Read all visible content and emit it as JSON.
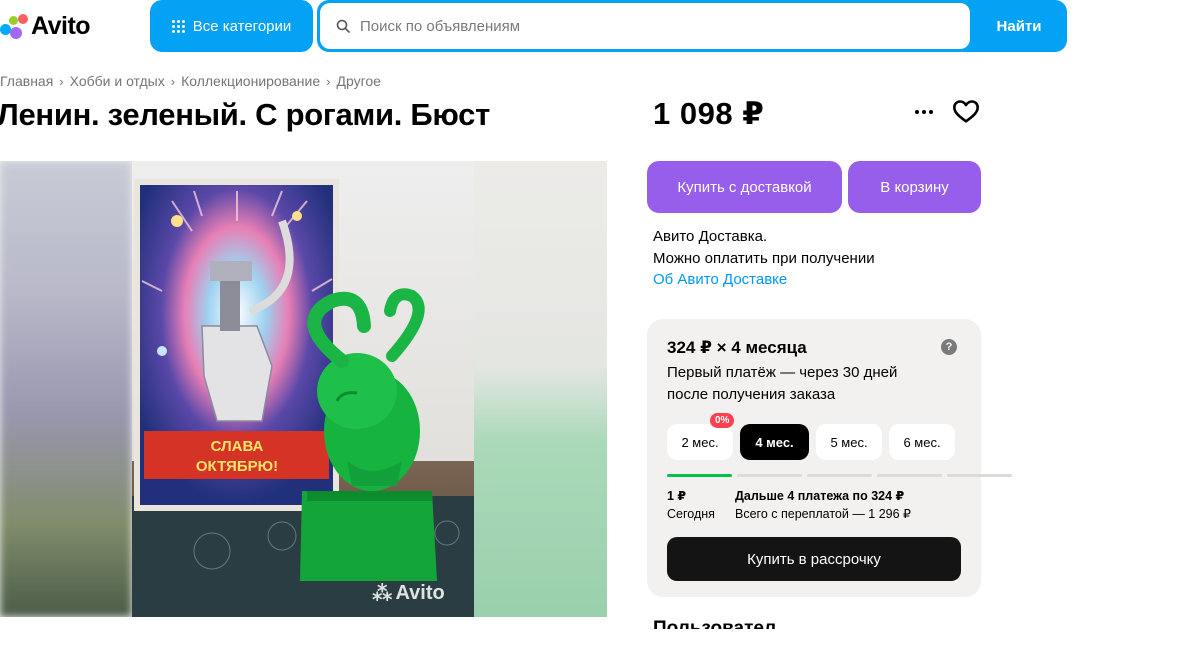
{
  "header": {
    "logo_text": "Avito",
    "logo_colors": [
      "#00aaff",
      "#97cf26",
      "#a169f7",
      "#ff6163"
    ],
    "categories_label": "Все категории",
    "search_placeholder": "Поиск по объявлениям",
    "find_label": "Найти",
    "accent_color": "#04a2f5"
  },
  "breadcrumb": [
    "Главная",
    "Хобби и отдых",
    "Коллекционирование",
    "Другое"
  ],
  "listing": {
    "title": "Ленин. зеленый. С рогами. Бюст",
    "price": "1 098 ₽",
    "photo_watermark": "Avito",
    "photo_content": {
      "card_text_line1": "СЛАВА",
      "card_text_line2": "ОКТЯБРЮ!"
    }
  },
  "actions": {
    "buy_delivery": "Купить с доставкой",
    "to_cart": "В корзину",
    "button_color": "#965eeb"
  },
  "delivery": {
    "line1": "Авито Доставка.",
    "line2": "Можно оплатить при получении",
    "link": "Об Авито Доставке"
  },
  "installment": {
    "title": "324 ₽ × 4 месяца",
    "subtitle": "Первый платёж — через 30 дней после получения заказа",
    "terms": [
      "2 мес.",
      "4 мес.",
      "5 мес.",
      "6 мес."
    ],
    "selected_term": "4 мес.",
    "badge": "0%",
    "first_amount": "1 ₽",
    "first_when": "Сегодня",
    "next_payments": "Дальше 4 платежа по 324 ₽",
    "total_overpay": "Всего с переплатой — 1 296 ₽",
    "buy_button": "Купить в рассрочку"
  },
  "seller_heading_partial": "Пользовател"
}
